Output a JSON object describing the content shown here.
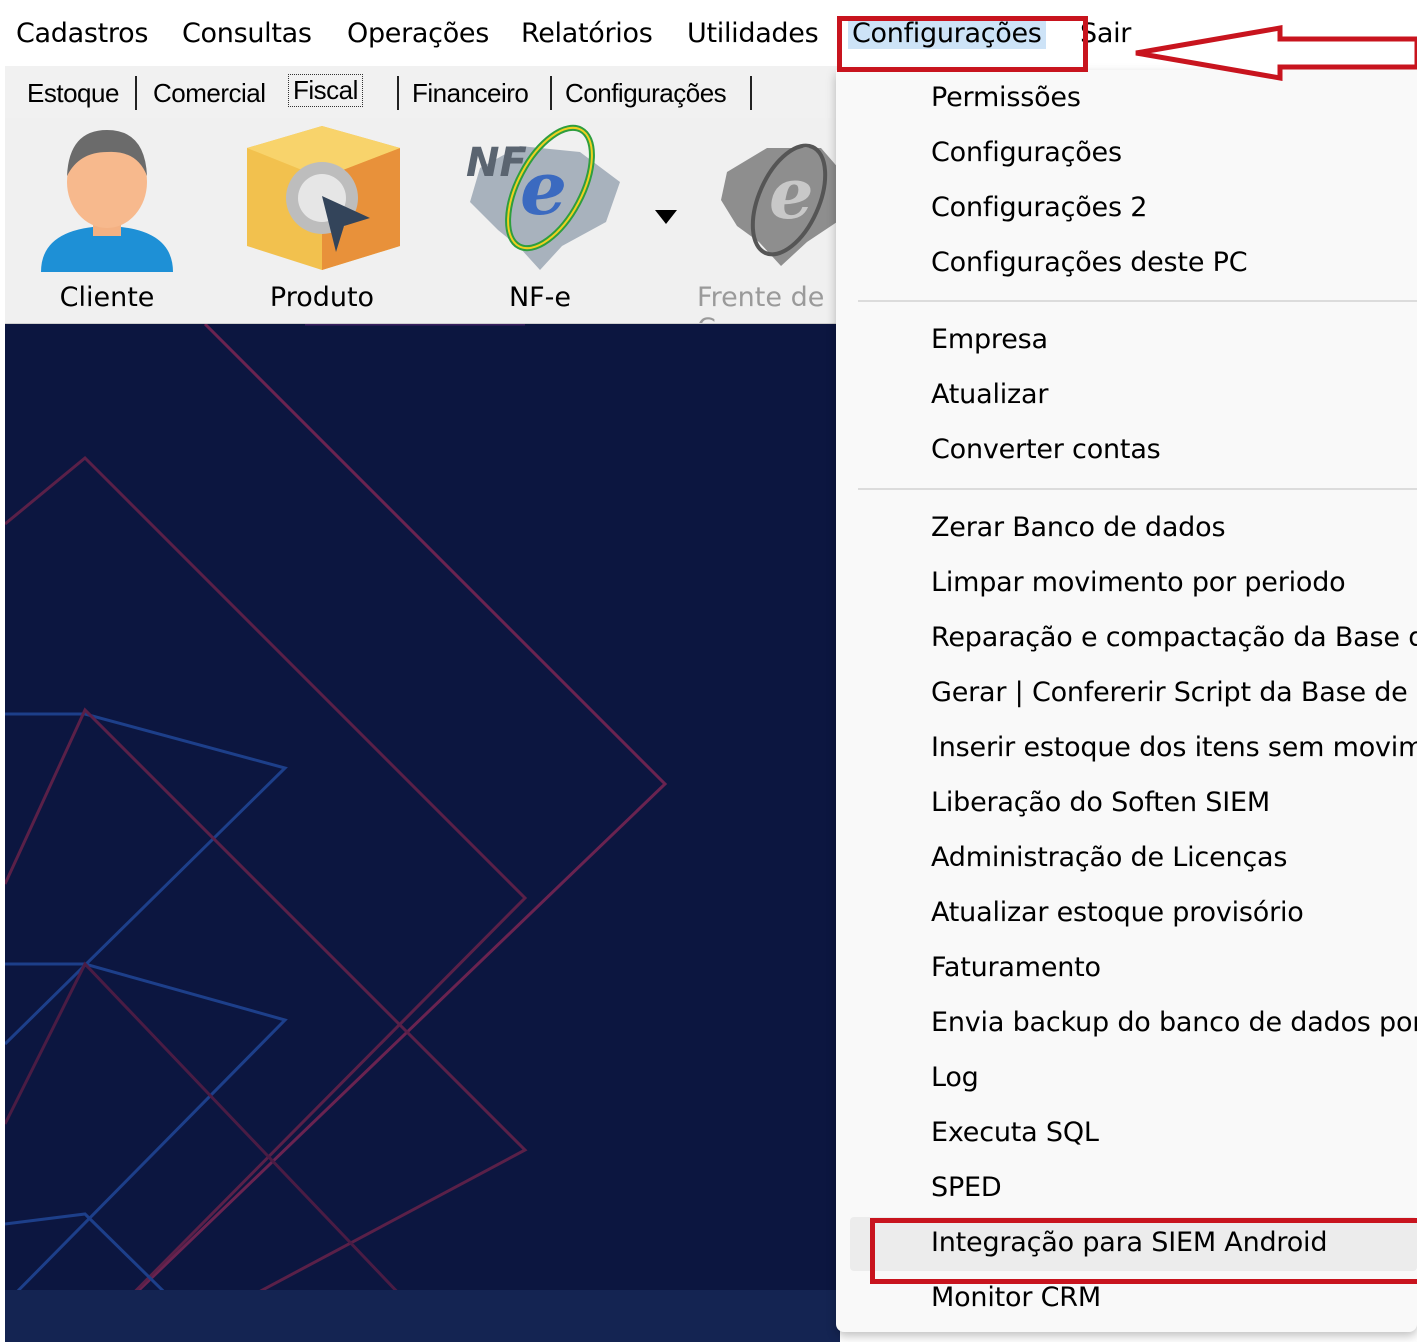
{
  "menubar": {
    "items": [
      {
        "label": "Cadastros"
      },
      {
        "label": "Consultas"
      },
      {
        "label": "Operações"
      },
      {
        "label": "Relatórios"
      },
      {
        "label": "Utilidades"
      },
      {
        "label": "Configurações"
      },
      {
        "label": "Sair"
      }
    ]
  },
  "tabs": [
    {
      "label": "Estoque"
    },
    {
      "label": "Comercial"
    },
    {
      "label": "Fiscal"
    },
    {
      "label": "Financeiro"
    },
    {
      "label": "Configurações"
    }
  ],
  "toolbar": {
    "buttons": [
      {
        "label": "Cliente",
        "icon": "person-icon"
      },
      {
        "label": "Produto",
        "icon": "product-box-icon"
      },
      {
        "label": "NF-e",
        "icon": "nfe-icon"
      },
      {
        "label": "Frente de C",
        "icon": "nfce-icon"
      }
    ]
  },
  "dropdown": {
    "items": [
      {
        "label": "Permissões"
      },
      {
        "label": "Configurações"
      },
      {
        "label": "Configurações 2"
      },
      {
        "label": "Configurações deste PC"
      },
      {
        "label": "Empresa"
      },
      {
        "label": "Atualizar"
      },
      {
        "label": "Converter contas"
      },
      {
        "label": "Zerar Banco de dados"
      },
      {
        "label": "Limpar movimento por periodo"
      },
      {
        "label": "Reparação e compactação da Base d"
      },
      {
        "label": "Gerar | Confererir Script da Base de D"
      },
      {
        "label": "Inserir estoque dos itens sem movim"
      },
      {
        "label": "Liberação do Soften SIEM"
      },
      {
        "label": "Administração de Licenças"
      },
      {
        "label": "Atualizar estoque provisório"
      },
      {
        "label": "Faturamento"
      },
      {
        "label": "Envia backup do banco de dados por"
      },
      {
        "label": "Log"
      },
      {
        "label": "Executa SQL"
      },
      {
        "label": "SPED"
      },
      {
        "label": "Integração para SIEM Android"
      },
      {
        "label": "Monitor CRM"
      }
    ]
  },
  "colors": {
    "annotation": "#c8141e",
    "background": "#0c1640",
    "highlight": "#cde3f7"
  }
}
